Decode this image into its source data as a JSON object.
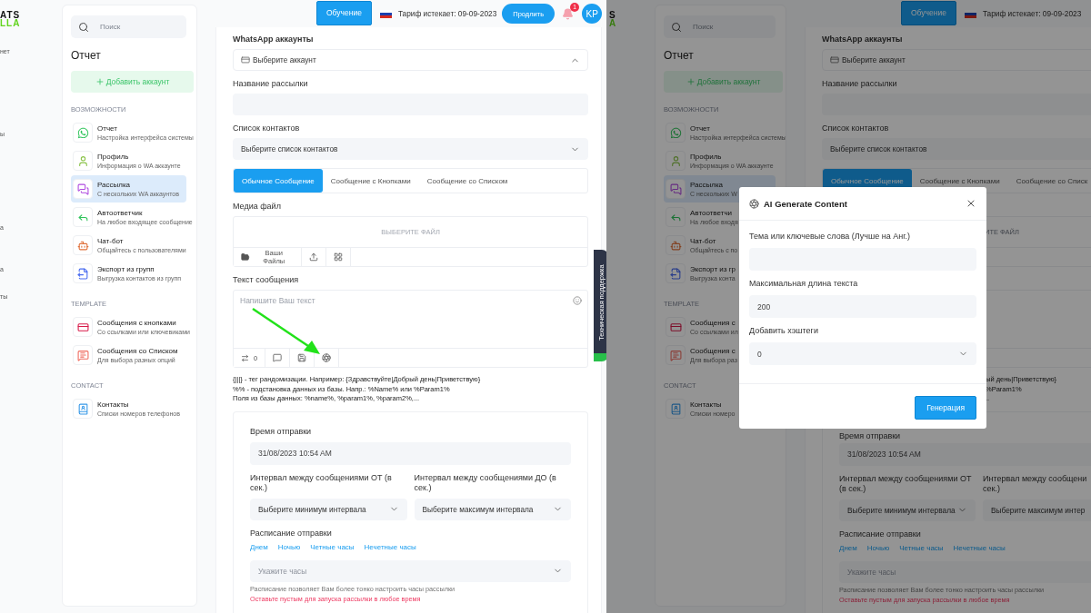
{
  "left_pane": {
    "logo": {
      "line_1": "ATS",
      "line_2": "LLA"
    },
    "nav_fragments": [
      "нет",
      "ы",
      "а",
      "а",
      "ты"
    ],
    "header": {
      "training_button": "Обучение",
      "tariff": "Тариф истекает: 09-09-2023",
      "renew_button": "Продлить",
      "notification_count": "1",
      "avatar": "KP"
    },
    "sidebar": {
      "search_placeholder": "Поиск",
      "title": "Отчет",
      "add_button": "Добавить аккаунт",
      "sections": [
        {
          "heading": "ВОЗМОЖНОСТИ",
          "items": [
            {
              "title": "Отчет",
              "subtitle": "Настройка интерфейса системы",
              "selected": false
            },
            {
              "title": "Профиль",
              "subtitle": "Информация о WA аккаунте",
              "selected": false
            },
            {
              "title": "Рассылка",
              "subtitle": "С нескольких WA аккаунтов",
              "selected": true
            },
            {
              "title": "Автоответчик",
              "subtitle": "На любое входящее сообщение",
              "selected": false
            },
            {
              "title": "Чат-бот",
              "subtitle": "Общайтесь с пользователями",
              "selected": false
            },
            {
              "title": "Экспорт из групп",
              "subtitle": "Выгрузка контактов из групп",
              "selected": false
            }
          ]
        },
        {
          "heading": "TEMPLATE",
          "items": [
            {
              "title": "Сообщения с кнопками",
              "subtitle": "Со ссылками или ключевиками",
              "selected": false
            },
            {
              "title": "Сообщения со Списком",
              "subtitle": "Для выбора разных опций",
              "selected": false
            }
          ]
        },
        {
          "heading": "CONTACT",
          "items": [
            {
              "title": "Контакты",
              "subtitle": "Списки номеров телефонов",
              "selected": false
            }
          ]
        }
      ]
    },
    "form": {
      "account_label": "WhatsApp аккаунты",
      "account_select": {
        "value": "Выберите аккаунт",
        "expanded": true
      },
      "name_label": "Название рассылки",
      "contacts_label": "Список контактов",
      "contacts_select": "Выберите список контактов",
      "message_tabs": [
        {
          "label": "Обычное Сообщение",
          "selected": true
        },
        {
          "label": "Сообщение с Кнопками",
          "selected": false
        },
        {
          "label": "Сообщение со Списком",
          "selected": false
        }
      ],
      "media_label": "Медиа файл",
      "media_choose": "ВЫБЕРИТЕ ФАЙЛ",
      "media_files_button": "Ваши Файлы",
      "text_label": "Текст сообщения",
      "text_placeholder": "Напишите Ваш текст",
      "counter": "0",
      "help_lines": [
        "{|||} - тег рандомизации. Например: {Здравствуйте|Добрый день|Приветствую}",
        "%% - подстановка данных из базы. Напр.: %Name% или %Param1%",
        "Поля из базы данных: %name%, %param1%, %param2%,..."
      ],
      "schedule": {
        "time_label": "Время отправки",
        "time_value": "31/08/2023 10:54 AM",
        "interval_from_label": "Интервал между сообщениями ОТ (в сек.)",
        "interval_from_select": "Выберите минимум интервала",
        "interval_to_label": "Интервал между сообщениями ДО (в сек.)",
        "interval_to_select": "Выберите максимум интервала",
        "schedule_label": "Расписание отправки",
        "presets": [
          "Днем",
          "Ночью",
          "Четные часы",
          "Нечетные часы"
        ],
        "hours_placeholder": "Укажите часы",
        "hint": "Расписание позволяет Вам более тонко настроить часы рассылки",
        "warning": "Оставьте пустым для запуска рассылки в любое время"
      }
    },
    "support_tab": "Техническая поддержка"
  },
  "right_pane": {
    "logo": {
      "line_1": "S",
      "line_2": "A"
    },
    "header": {
      "training_button": "Обучение",
      "tariff": "Тариф истекает: 09-09-2023"
    },
    "sidebar": {
      "search_placeholder": "Поиск",
      "title": "Отчет",
      "add_button": "Добавить аккаунт",
      "sections": [
        {
          "heading": "ВОЗМОЖНОСТИ",
          "items": [
            {
              "title": "Отчет",
              "subtitle": "Настройка интерфейса системы",
              "selected": false
            },
            {
              "title": "Профиль",
              "subtitle": "Информация о WA аккаунте",
              "selected": false
            },
            {
              "title": "Рассылка",
              "subtitle": "С нескольких W",
              "selected": true
            },
            {
              "title": "Автоответчи",
              "subtitle": "На любое входя",
              "selected": false
            },
            {
              "title": "Чат-бот",
              "subtitle": "Общайтесь с по",
              "selected": false
            },
            {
              "title": "Экспорт из гр",
              "subtitle": "Выгрузка конта",
              "selected": false
            }
          ]
        },
        {
          "heading": "TEMPLATE",
          "items": [
            {
              "title": "Сообщения с",
              "subtitle": "Со ссылками ил",
              "selected": false
            },
            {
              "title": "Сообщения с",
              "subtitle": "Для выбора раз",
              "selected": false
            }
          ]
        },
        {
          "heading": "CONTACT",
          "items": [
            {
              "title": "Контакты",
              "subtitle": "Списки номеро",
              "selected": false
            }
          ]
        }
      ]
    },
    "form": {
      "account_label": "WhatsApp аккаунты",
      "account_select": {
        "value": "Выберите аккаунт"
      },
      "name_label": "Название рассылки",
      "contacts_label": "Список контактов",
      "contacts_select": "Выберите список контактов",
      "message_tabs": [
        {
          "label": "Обычное Сообщение",
          "selected": true
        },
        {
          "label": "Сообщение с Кнопками",
          "selected": false
        },
        {
          "label": "Сообщение со Списк",
          "selected": false
        }
      ],
      "media_choose": "ИТЕ ФАЙЛ",
      "help_lines": [
        "ый день|Приветствую}",
        "%Param1%",
        ".."
      ],
      "schedule": {
        "time_label": "Время отправки",
        "time_value": "31/08/2023 10:54 AM",
        "interval_from_label": "Интервал между сообщениями ОТ (в сек.)",
        "interval_from_select": "Выберите минимум интервала",
        "interval_to_label": "Интервал между сообщени\nсек.)",
        "interval_to_select": "Выберите максимум интер",
        "schedule_label": "Расписание отправки",
        "presets": [
          "Днем",
          "Ночью",
          "Четные часы",
          "Нечетные часы"
        ],
        "hours_placeholder": "Укажите часы",
        "hint": "Расписание позволяет Вам более тонко настроить часы рассылки",
        "warning": "Оставьте пустым для запуска рассылки в любое время"
      }
    },
    "dialog": {
      "title": "AI Generate Content",
      "fields": [
        {
          "kind": "text",
          "label": "Тема или ключевые слова (Лучше на Анг.)"
        },
        {
          "kind": "text",
          "label": "Максимальная длина текста",
          "value": "200"
        },
        {
          "kind": "select",
          "label": "Добавить хэштеги",
          "value": "0"
        }
      ],
      "generate_button": "Генерация"
    }
  }
}
